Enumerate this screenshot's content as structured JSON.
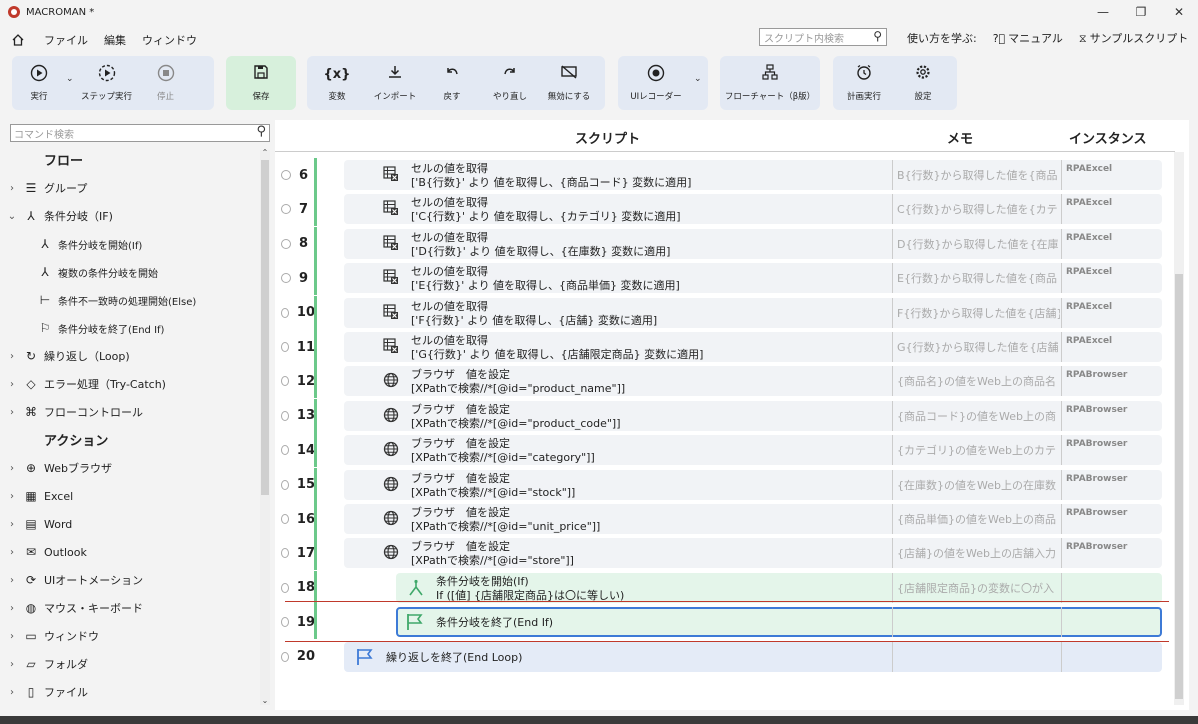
{
  "window": {
    "title": "MACROMAN *",
    "minimize": "—",
    "maximize": "❐",
    "close": "✕"
  },
  "menu": {
    "items": [
      "ファイル",
      "編集",
      "ウィンドウ"
    ],
    "search_placeholder": "スクリプト内検索",
    "help": [
      "使い方を学ぶ:",
      "マニュアル",
      "サンプルスクリプト"
    ]
  },
  "toolbar": {
    "run": "実行",
    "step_run": "ステップ実行",
    "stop": "停止",
    "save": "保存",
    "variable": "変数",
    "import": "インポート",
    "undo": "戻す",
    "redo": "やり直し",
    "disable": "無効にする",
    "ui_recorder": "UIレコーダー",
    "flowchart": "フローチャート（β版）",
    "schedule": "計画実行",
    "settings": "設定"
  },
  "sidebar": {
    "search_placeholder": "コマンド検索",
    "flow_title": "フロー",
    "action_title": "アクション",
    "flow_items": [
      {
        "label": "グループ",
        "chev": "›",
        "icon": "☰"
      },
      {
        "label": "条件分岐（IF)",
        "chev": "⌄",
        "icon": "⅄"
      }
    ],
    "if_children": [
      {
        "label": "条件分岐を開始(If)",
        "icon": "⅄"
      },
      {
        "label": "複数の条件分岐を開始",
        "icon": "⅄"
      },
      {
        "label": "条件不一致時の処理開始(Else)",
        "icon": "⊢"
      },
      {
        "label": "条件分岐を終了(End If)",
        "icon": "⚐"
      }
    ],
    "flow_items_after": [
      {
        "label": "繰り返し（Loop)",
        "chev": "›",
        "icon": "↻"
      },
      {
        "label": "エラー処理（Try-Catch)",
        "chev": "›",
        "icon": "◇"
      },
      {
        "label": "フローコントロール",
        "chev": "›",
        "icon": "⌘"
      }
    ],
    "action_items": [
      {
        "label": "Webブラウザ",
        "icon": "⊕"
      },
      {
        "label": "Excel",
        "icon": "▦"
      },
      {
        "label": "Word",
        "icon": "▤"
      },
      {
        "label": "Outlook",
        "icon": "✉"
      },
      {
        "label": "UIオートメーション",
        "icon": "⟳"
      },
      {
        "label": "マウス・キーボード",
        "icon": "◍"
      },
      {
        "label": "ウィンドウ",
        "icon": "▭"
      },
      {
        "label": "フォルダ",
        "icon": "▱"
      },
      {
        "label": "ファイル",
        "icon": "▯"
      }
    ]
  },
  "script": {
    "headers": {
      "script": "スクリプト",
      "memo": "メモ",
      "instance": "インスタンス"
    },
    "rows": [
      {
        "num": "6",
        "kind": "excel",
        "line1": "セルの値を取得",
        "line2": "['B{行数}' より 値を取得し、{商品コード} 変数に適用]",
        "memo": "B{行数}から取得した値を{商品",
        "instance": "RPAExcel"
      },
      {
        "num": "7",
        "kind": "excel",
        "line1": "セルの値を取得",
        "line2": "['C{行数}' より 値を取得し、{カテゴリ} 変数に適用]",
        "memo": "C{行数}から取得した値を{カテ",
        "instance": "RPAExcel"
      },
      {
        "num": "8",
        "kind": "excel",
        "line1": "セルの値を取得",
        "line2": "['D{行数}' より 値を取得し、{在庫数} 変数に適用]",
        "memo": "D{行数}から取得した値を{在庫",
        "instance": "RPAExcel"
      },
      {
        "num": "9",
        "kind": "excel",
        "line1": "セルの値を取得",
        "line2": "['E{行数}' より 値を取得し、{商品単価} 変数に適用]",
        "memo": "E{行数}から取得した値を{商品",
        "instance": "RPAExcel"
      },
      {
        "num": "10",
        "kind": "excel",
        "line1": "セルの値を取得",
        "line2": "['F{行数}' より 値を取得し、{店舗} 変数に適用]",
        "memo": "F{行数}から取得した値を{店舗}",
        "instance": "RPAExcel"
      },
      {
        "num": "11",
        "kind": "excel",
        "line1": "セルの値を取得",
        "line2": "['G{行数}' より 値を取得し、{店舗限定商品} 変数に適用]",
        "memo": "G{行数}から取得した値を{店舗",
        "instance": "RPAExcel"
      },
      {
        "num": "12",
        "kind": "browser",
        "line1": "ブラウザ　値を設定",
        "line2": "[XPathで検索//*[@id=\"product_name\"]]",
        "memo": "{商品名}の値をWeb上の商品名",
        "instance": "RPABrowser"
      },
      {
        "num": "13",
        "kind": "browser",
        "line1": "ブラウザ　値を設定",
        "line2": "[XPathで検索//*[@id=\"product_code\"]]",
        "memo": "{商品コード}の値をWeb上の商",
        "instance": "RPABrowser"
      },
      {
        "num": "14",
        "kind": "browser",
        "line1": "ブラウザ　値を設定",
        "line2": "[XPathで検索//*[@id=\"category\"]]",
        "memo": "{カテゴリ}の値をWeb上のカテ",
        "instance": "RPABrowser"
      },
      {
        "num": "15",
        "kind": "browser",
        "line1": "ブラウザ　値を設定",
        "line2": "[XPathで検索//*[@id=\"stock\"]]",
        "memo": "{在庫数}の値をWeb上の在庫数",
        "instance": "RPABrowser"
      },
      {
        "num": "16",
        "kind": "browser",
        "line1": "ブラウザ　値を設定",
        "line2": "[XPathで検索//*[@id=\"unit_price\"]]",
        "memo": "{商品単価}の値をWeb上の商品",
        "instance": "RPABrowser"
      },
      {
        "num": "17",
        "kind": "browser",
        "line1": "ブラウザ　値を設定",
        "line2": "[XPathで検索//*[@id=\"store\"]]",
        "memo": "{店舗}の値をWeb上の店舗入力",
        "instance": "RPABrowser"
      },
      {
        "num": "18",
        "kind": "if",
        "line1": "条件分岐を開始(If)",
        "line2": "If ([値] {店舗限定商品}は〇に等しい)",
        "memo": "{店舗限定商品}の変数に〇が入",
        "instance": ""
      },
      {
        "num": "19",
        "kind": "endif",
        "line1": "条件分岐を終了(End If)",
        "line2": "",
        "memo": "",
        "instance": ""
      },
      {
        "num": "20",
        "kind": "endloop",
        "line1": "繰り返しを終了(End Loop)",
        "line2": "",
        "memo": "",
        "instance": ""
      }
    ]
  },
  "colors": {
    "accent_blue": "#3d7ad6",
    "green_bar": "#6cc98a",
    "drop_line": "#c0392b"
  }
}
